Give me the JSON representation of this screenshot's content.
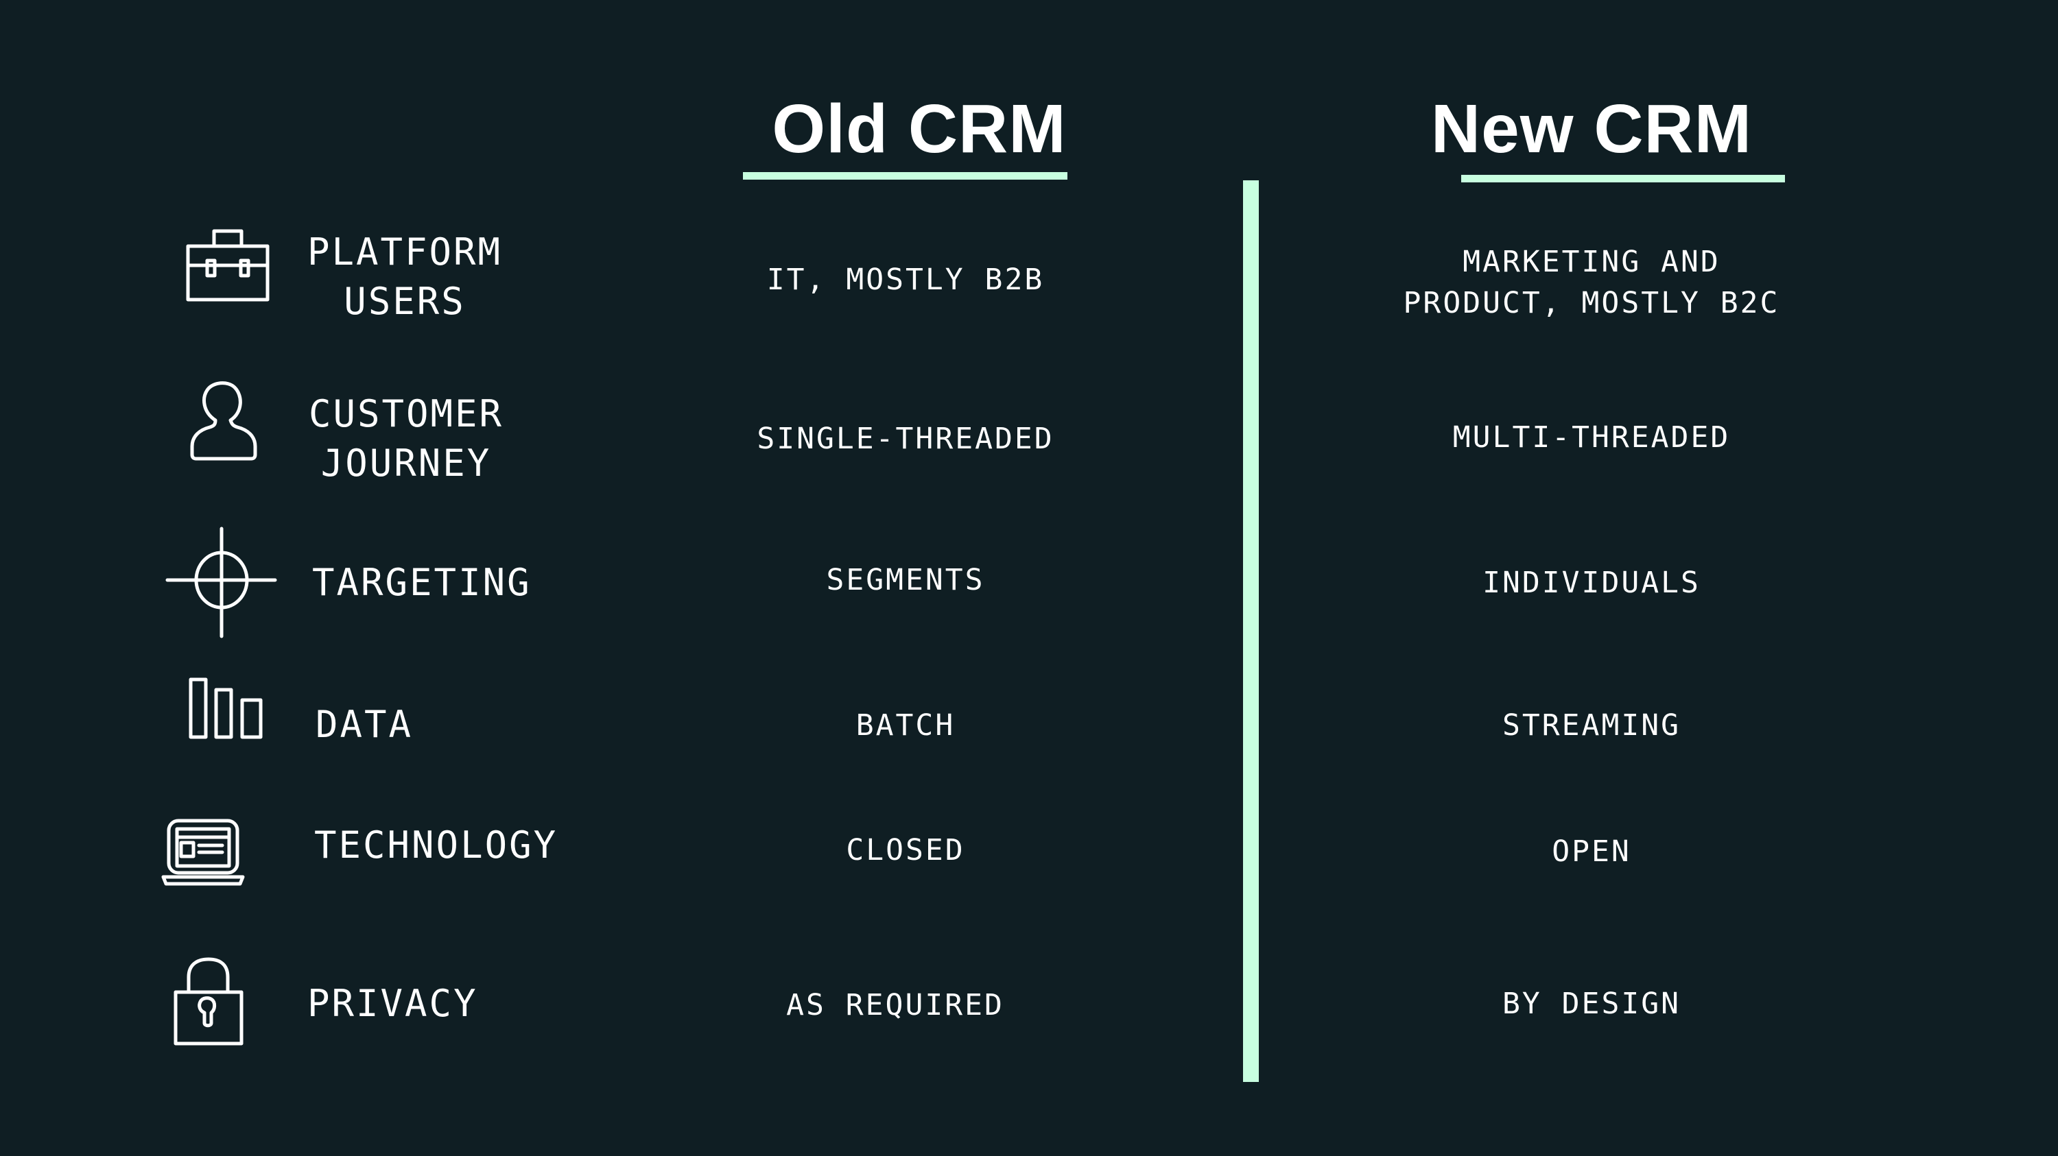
{
  "headers": {
    "old": "Old CRM",
    "new": "New CRM"
  },
  "colors": {
    "background": "#0f1e23",
    "accent": "#c8ffe0",
    "text": "#ffffff"
  },
  "rows": [
    {
      "icon": "briefcase-icon",
      "label": "PLATFORM\nUSERS",
      "old": "IT, MOSTLY B2B",
      "new": "MARKETING AND\nPRODUCT, MOSTLY B2C"
    },
    {
      "icon": "user-icon",
      "label": "CUSTOMER\nJOURNEY",
      "old": "SINGLE-THREADED",
      "new": "MULTI-THREADED"
    },
    {
      "icon": "crosshair-icon",
      "label": "TARGETING",
      "old": "SEGMENTS",
      "new": "INDIVIDUALS"
    },
    {
      "icon": "bar-chart-icon",
      "label": "DATA",
      "old": "BATCH",
      "new": "STREAMING"
    },
    {
      "icon": "laptop-icon",
      "label": "TECHNOLOGY",
      "old": "CLOSED",
      "new": "OPEN"
    },
    {
      "icon": "padlock-icon",
      "label": "PRIVACY",
      "old": "AS REQUIRED",
      "new": "BY DESIGN"
    }
  ]
}
